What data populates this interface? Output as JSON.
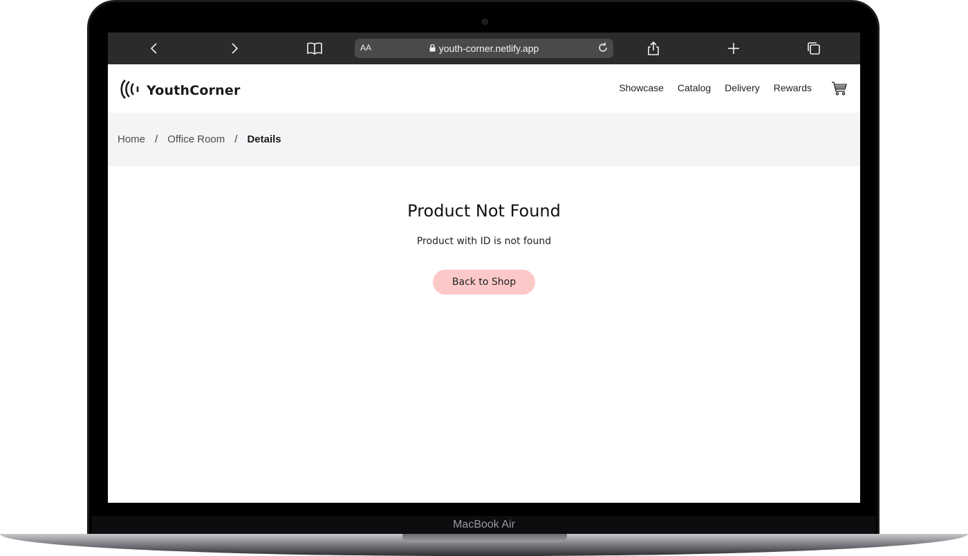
{
  "device": {
    "label": "MacBook Air"
  },
  "browser": {
    "text_size_label": "AA",
    "url": "youth-corner.netlify.app",
    "icons": [
      "back-icon",
      "forward-icon",
      "bookmarks-icon",
      "lock-icon",
      "reload-icon",
      "share-icon",
      "new-tab-icon",
      "tabs-icon"
    ]
  },
  "site": {
    "brand": "YouthCorner",
    "logo_icon": "logo-icon",
    "nav": [
      {
        "label": "Showcase"
      },
      {
        "label": "Catalog"
      },
      {
        "label": "Delivery"
      },
      {
        "label": "Rewards"
      }
    ],
    "cart_icon": "cart-icon"
  },
  "breadcrumb": {
    "items": [
      "Home",
      "Office Room",
      "Details"
    ],
    "separator": "/"
  },
  "main": {
    "title": "Product Not Found",
    "message": "Product with ID is not found",
    "back_button": "Back to Shop"
  },
  "colors": {
    "browser_toolbar": "#2b2b2d",
    "breadcrumb_bg": "#f3f4f6",
    "button_bg": "#fdc8c8"
  }
}
